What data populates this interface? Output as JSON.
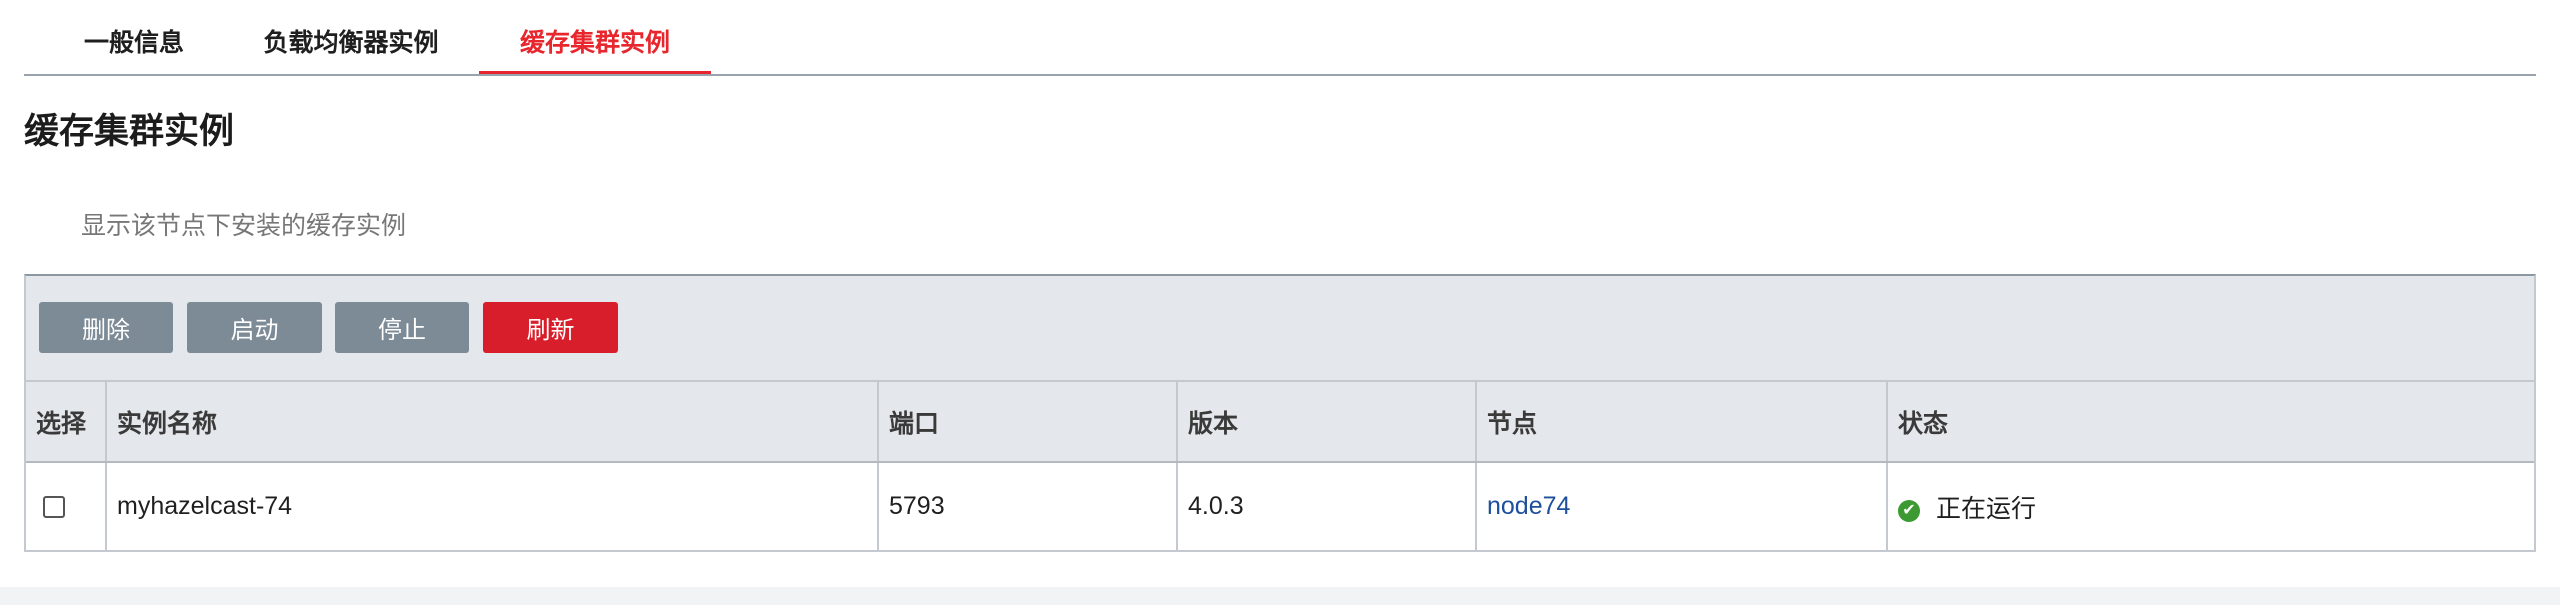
{
  "tabs": [
    {
      "label": "一般信息",
      "active": false
    },
    {
      "label": "负载均衡器实例",
      "active": false
    },
    {
      "label": "缓存集群实例",
      "active": true
    }
  ],
  "section": {
    "title": "缓存集群实例",
    "description": "显示该节点下安装的缓存实例"
  },
  "toolbar": {
    "delete_label": "删除",
    "start_label": "启动",
    "stop_label": "停止",
    "refresh_label": "刷新"
  },
  "table": {
    "columns": [
      "选择",
      "实例名称",
      "端口",
      "版本",
      "节点",
      "状态"
    ],
    "rows": [
      {
        "selected": false,
        "name": "myhazelcast-74",
        "port": "5793",
        "version": "4.0.3",
        "node": "node74",
        "status": "正在运行",
        "status_icon": "check-circle-icon"
      }
    ]
  },
  "colors": {
    "accent": "#e8262d",
    "button_gray": "#7d8b97",
    "button_red": "#d81e2a",
    "link": "#1e4f9c",
    "status_ok": "#3d9a33"
  }
}
